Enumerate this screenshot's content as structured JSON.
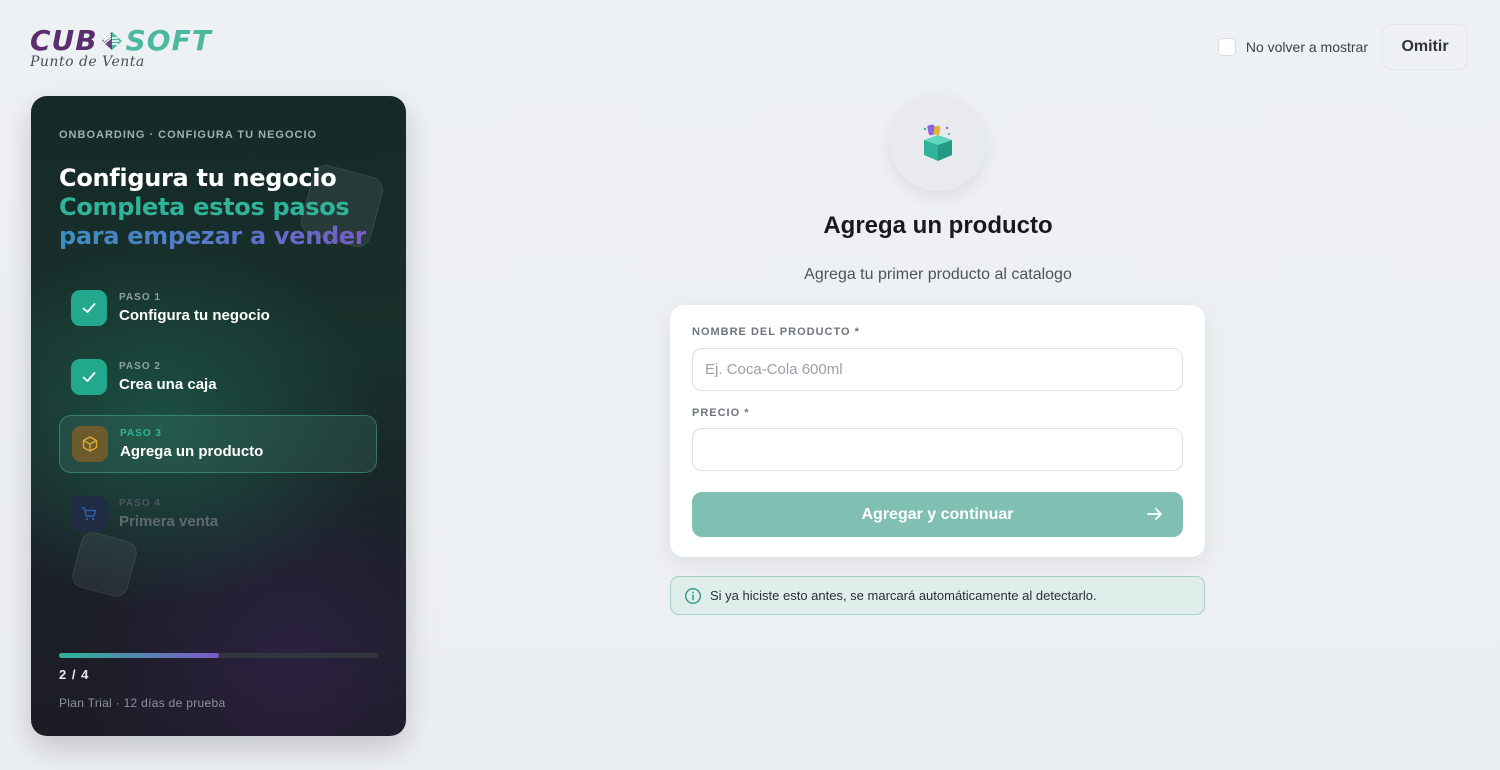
{
  "brand": {
    "left": "CUB",
    "right": "SOFT",
    "subtitle": "Punto de Venta"
  },
  "topbar": {
    "dont_show_label": "No volver a mostrar",
    "skip_label": "Omitir"
  },
  "sidebar": {
    "eyebrow": "ONBOARDING · CONFIGURA TU NEGOCIO",
    "title_line1": "Configura tu negocio",
    "title_line2": "Completa estos pasos",
    "title_line3": "para empezar a vender",
    "steps": [
      {
        "kicker": "PASO 1",
        "label": "Configura tu negocio",
        "state": "done",
        "icon": "check-icon"
      },
      {
        "kicker": "PASO 2",
        "label": "Crea una caja",
        "state": "done",
        "icon": "check-icon"
      },
      {
        "kicker": "PASO 3",
        "label": "Agrega un producto",
        "state": "active",
        "icon": "box-icon"
      },
      {
        "kicker": "PASO 4",
        "label": "Primera venta",
        "state": "pending",
        "icon": "cart-icon"
      }
    ],
    "progress": 0.5,
    "progress_text": "2 / 4",
    "plan_text": "Plan Trial · 12 días de prueba"
  },
  "main": {
    "icon": "product-box-icon",
    "title": "Agrega un producto",
    "subtitle": "Agrega tu primer producto al catalogo",
    "form": {
      "name_label": "NOMBRE DEL PRODUCTO *",
      "name_placeholder": "Ej. Coca-Cola 600ml",
      "name_value": "",
      "price_label": "PRECIO *",
      "price_placeholder": "",
      "price_value": "",
      "submit_label": "Agregar y continuar"
    },
    "note": "Si ya hiciste esto antes, se marcará automáticamente al detectarlo."
  },
  "colors": {
    "accent": "#2fb39a",
    "brand_purple": "#5b2f6e",
    "submit_bg": "#7fc0b3"
  }
}
